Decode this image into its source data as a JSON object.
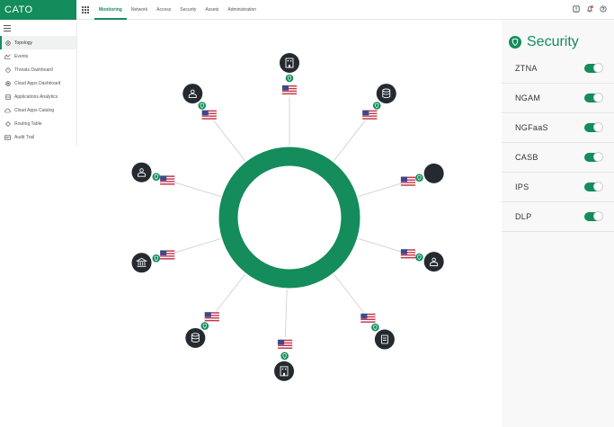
{
  "header": {
    "logo": "CATO",
    "tabs": [
      {
        "label": "Monitoring",
        "active": true
      },
      {
        "label": "Network",
        "active": false
      },
      {
        "label": "Access",
        "active": false
      },
      {
        "label": "Security",
        "active": false
      },
      {
        "label": "Assets",
        "active": false
      },
      {
        "label": "Administration",
        "active": false
      }
    ],
    "icons": [
      "alert-icon",
      "bell-icon",
      "help-icon"
    ]
  },
  "sidebar": {
    "items": [
      {
        "label": "Topology",
        "icon": "topology-icon",
        "active": true
      },
      {
        "label": "Events",
        "icon": "events-icon",
        "active": false
      },
      {
        "label": "Threats Dashboard",
        "icon": "threats-icon",
        "active": false
      },
      {
        "label": "Cloud Apps Dashboard",
        "icon": "cloud-apps-icon",
        "active": false
      },
      {
        "label": "Applications Analytics",
        "icon": "analytics-icon",
        "active": false
      },
      {
        "label": "Cloud Apps Catalog",
        "icon": "catalog-icon",
        "active": false
      },
      {
        "label": "Routing Table",
        "icon": "routing-icon",
        "active": false
      },
      {
        "label": "Audit Trail",
        "icon": "audit-icon",
        "active": false
      }
    ]
  },
  "security": {
    "title": "Security",
    "features": [
      {
        "label": "ZTNA",
        "enabled": true
      },
      {
        "label": "NGAM",
        "enabled": true
      },
      {
        "label": "NGFaaS",
        "enabled": true
      },
      {
        "label": "CASB",
        "enabled": true
      },
      {
        "label": "IPS",
        "enabled": true
      },
      {
        "label": "DLP",
        "enabled": true
      }
    ]
  },
  "topology": {
    "ring_color": "#148c5c",
    "nodes": [
      {
        "icon": "building-icon"
      },
      {
        "icon": "database-icon"
      },
      {
        "icon": "user-icon"
      },
      {
        "icon": "cloud-icon"
      },
      {
        "icon": "user-icon"
      },
      {
        "icon": "building-icon"
      },
      {
        "icon": "database-icon"
      },
      {
        "icon": "bank-icon"
      },
      {
        "icon": "document-icon"
      },
      {
        "icon": "user-icon"
      }
    ]
  },
  "colors": {
    "brand": "#148c5c",
    "node": "#242a2f"
  }
}
